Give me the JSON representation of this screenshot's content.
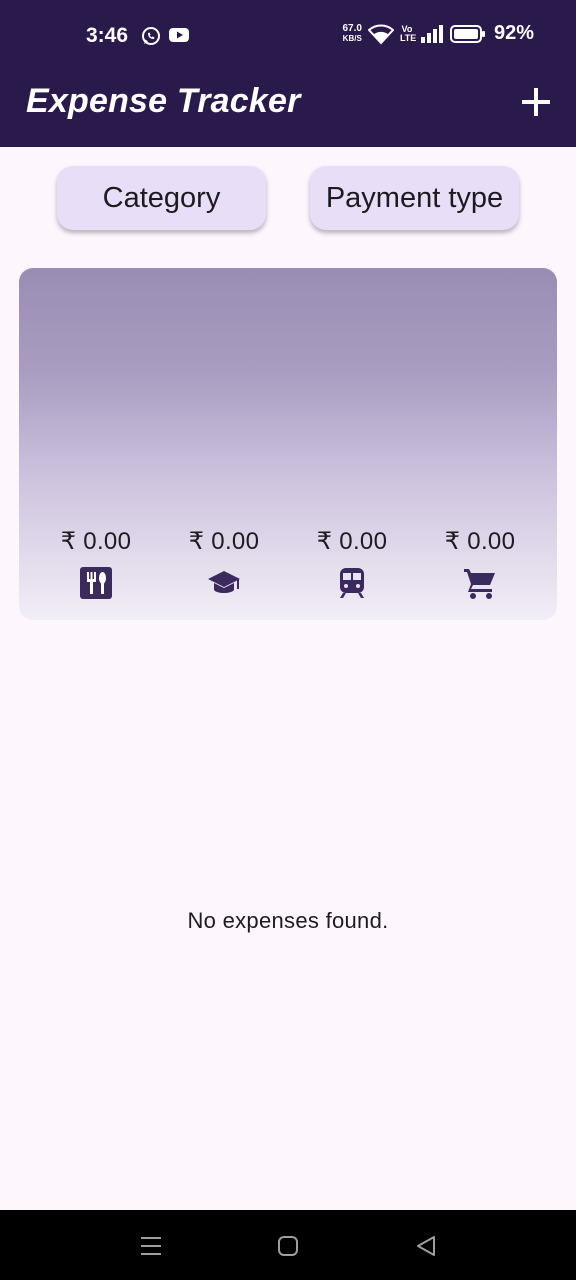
{
  "status_bar": {
    "time": "3:46",
    "net_speed_value": "67.0",
    "net_speed_unit": "KB/S",
    "volte": "Vo LTE",
    "battery": "92%",
    "icons": [
      "whatsapp-icon",
      "youtube-icon",
      "wifi-icon",
      "signal-icon",
      "battery-icon"
    ]
  },
  "app_bar": {
    "title": "Expense Tracker",
    "add_icon": "plus-icon"
  },
  "filters": {
    "category_label": "Category",
    "payment_type_label": "Payment type"
  },
  "summary": {
    "items": [
      {
        "amount": "₹ 0.00",
        "icon": "restaurant-icon"
      },
      {
        "amount": "₹ 0.00",
        "icon": "school-icon"
      },
      {
        "amount": "₹ 0.00",
        "icon": "train-icon"
      },
      {
        "amount": "₹ 0.00",
        "icon": "shopping-cart-icon"
      }
    ]
  },
  "empty_state": {
    "message": "No expenses found."
  },
  "colors": {
    "app_bar": "#2a1a4b",
    "background": "#fdf6fd",
    "button": "#e8def8",
    "icon": "#3b2a5e"
  }
}
